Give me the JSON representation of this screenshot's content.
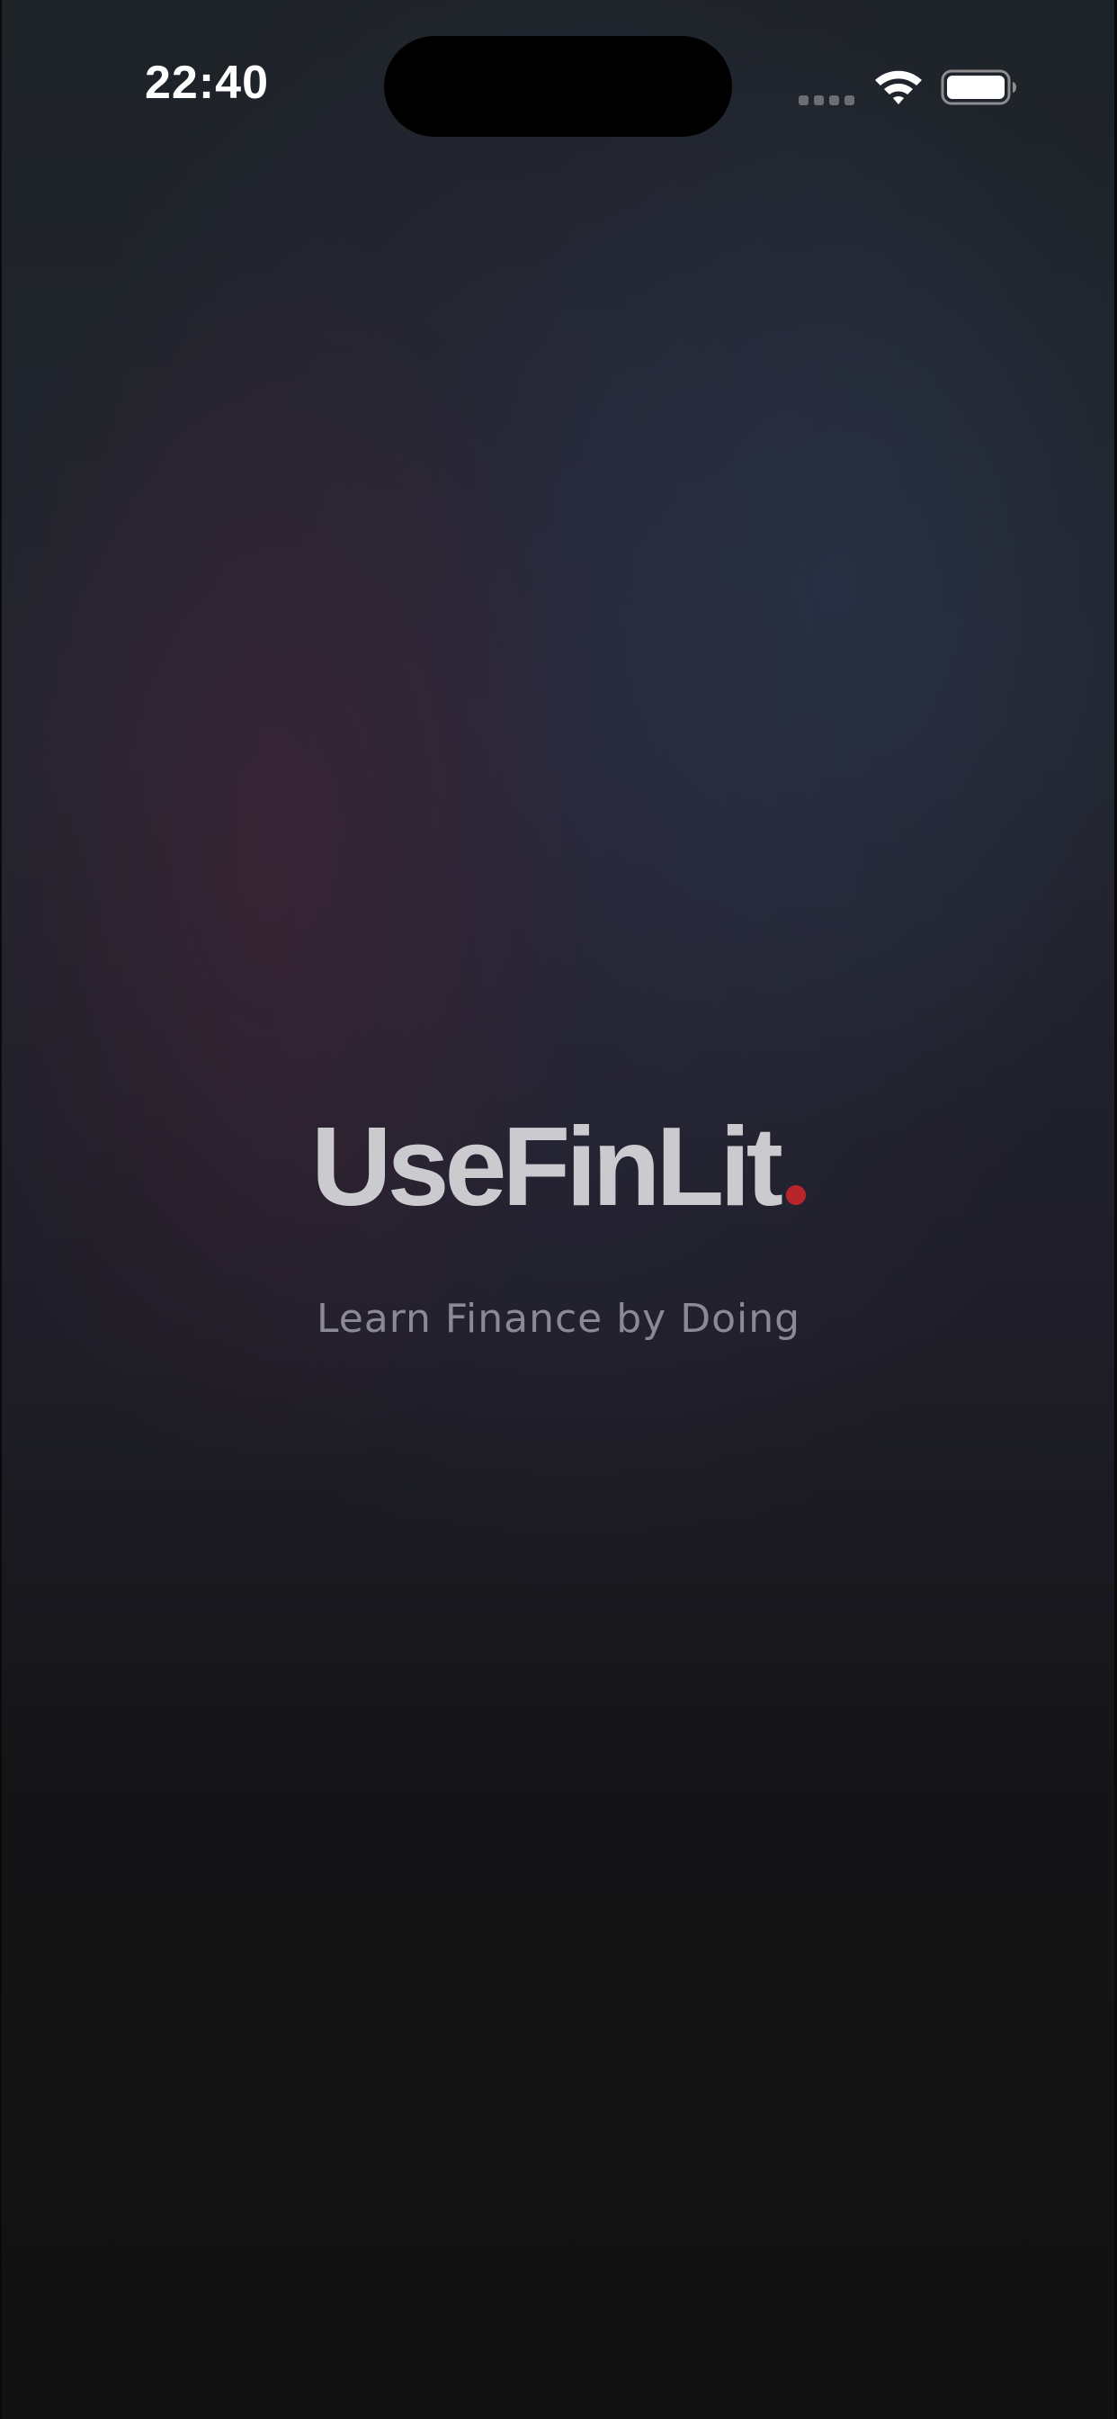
{
  "status_bar": {
    "time": "22:40",
    "icons": [
      "signal-icon",
      "wifi-icon",
      "battery-icon"
    ]
  },
  "splash": {
    "brand_name": "UseFinLit",
    "brand_dot_color": "#b8262c",
    "tagline": "Learn Finance by Doing"
  }
}
